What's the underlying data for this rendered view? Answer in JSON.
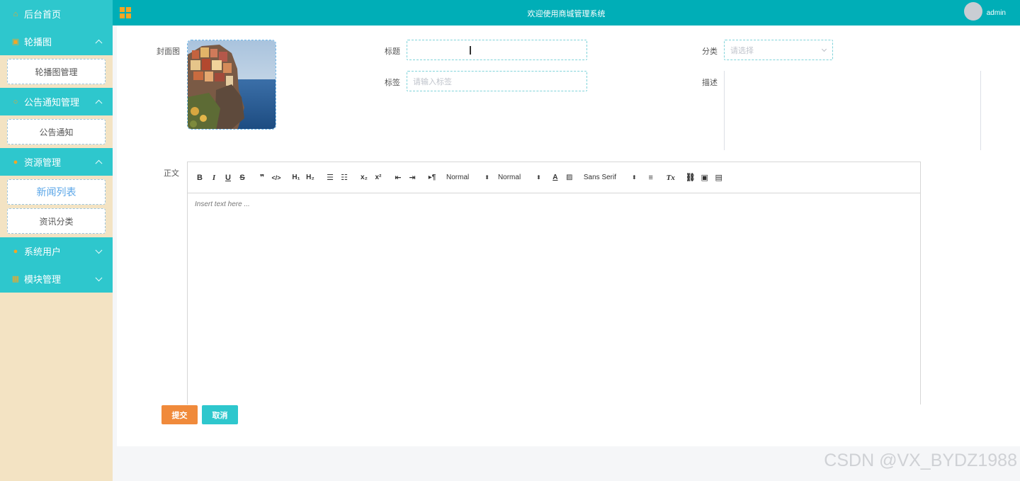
{
  "header": {
    "title": "欢迎使用商城管理系统",
    "user": "admin"
  },
  "sidebar": {
    "home": "后台首页",
    "groups": [
      {
        "label": "轮播图",
        "items": [
          "轮播图管理"
        ]
      },
      {
        "label": "公告通知管理",
        "items": [
          "公告通知"
        ]
      },
      {
        "label": "资源管理",
        "items": [
          "新闻列表",
          "资讯分类"
        ]
      },
      {
        "label": "系统用户",
        "items": []
      },
      {
        "label": "模块管理",
        "items": []
      }
    ],
    "active_item": "新闻列表"
  },
  "form": {
    "cover_label": "封面图",
    "title_label": "标题",
    "title_value": "",
    "category_label": "分类",
    "category_placeholder": "请选择",
    "tag_label": "标签",
    "tag_placeholder": "请输入标签",
    "desc_label": "描述",
    "body_label": "正文",
    "editor_placeholder": "Insert text here ...",
    "header_select": "Normal",
    "size_select": "Normal",
    "font_select": "Sans Serif",
    "submit": "提交",
    "cancel": "取消"
  },
  "colors": {
    "accent": "#2ec7cd",
    "header": "#00aeb7",
    "submit": "#f08a3b",
    "cancel": "#2ec7cd",
    "sidebar_bg": "#f3e3c3"
  },
  "watermark": "CSDN @VX_BYDZ1988"
}
